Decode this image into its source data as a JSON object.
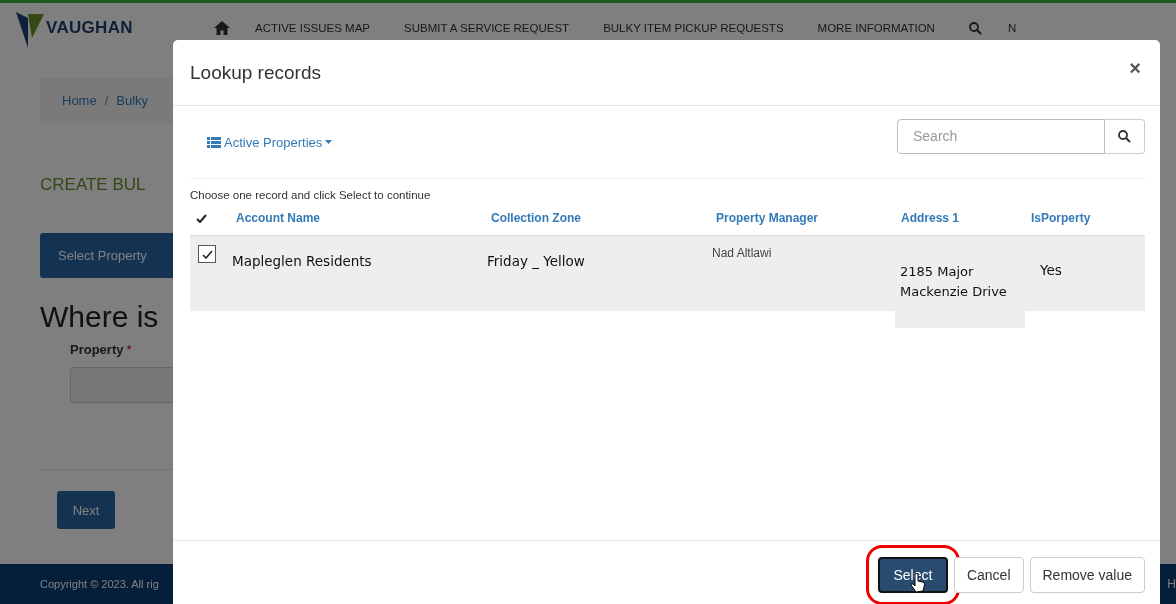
{
  "header": {
    "logo": "VAUGHAN",
    "nav": [
      {
        "label": "ACTIVE ISSUES MAP"
      },
      {
        "label": "SUBMIT A SERVICE REQUEST"
      },
      {
        "label": "BULKY ITEM PICKUP REQUESTS"
      },
      {
        "label": "MORE INFORMATION"
      }
    ],
    "nav_cut": "N"
  },
  "breadcrumb": {
    "separator": "/",
    "items": [
      "Home",
      "Bulky"
    ]
  },
  "page_title": "CREATE BUL",
  "step_button": "Select Property",
  "heading": "Where is",
  "field": {
    "label": "Property",
    "required_mark": "*"
  },
  "next_button": "Next",
  "footer": {
    "copyright": "Copyright © 2023. All rig",
    "cut_right": "H"
  },
  "modal": {
    "title": "Lookup records",
    "close": "×",
    "view_menu": "Active Properties",
    "search": {
      "placeholder": "Search"
    },
    "instruction": "Choose one record and click Select to continue",
    "columns": [
      "Account Name",
      "Collection Zone",
      "Property Manager",
      "Address 1",
      "IsPorperty"
    ],
    "rows": [
      {
        "checked": true,
        "cells": [
          "Mapleglen Residents",
          "Friday _ Yellow",
          "Nad Altlawi",
          "2185 Major Mackenzie Drive",
          "Yes"
        ]
      }
    ],
    "buttons": [
      {
        "label": "Select",
        "kind": "primary",
        "highlighted": true
      },
      {
        "label": "Cancel",
        "kind": "default",
        "highlighted": false
      },
      {
        "label": "Remove value",
        "kind": "default",
        "highlighted": false
      }
    ]
  }
}
